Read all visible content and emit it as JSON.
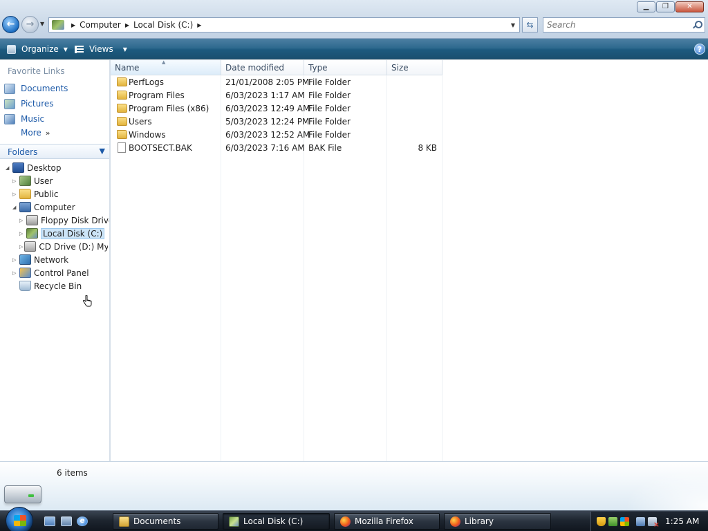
{
  "window": {
    "minimize": "▁",
    "maximize": "❐",
    "close": "✕"
  },
  "address": {
    "crumbs": [
      "Computer",
      "Local Disk (C:)"
    ]
  },
  "search": {
    "placeholder": "Search"
  },
  "toolbar": {
    "organize": "Organize",
    "views": "Views",
    "help": "?"
  },
  "navigation": {
    "favorites_heading": "Favorite Links",
    "favorites": [
      {
        "label": "Documents",
        "icon": "documents-icon"
      },
      {
        "label": "Pictures",
        "icon": "pictures-icon"
      },
      {
        "label": "Music",
        "icon": "music-icon"
      }
    ],
    "more": "More",
    "folders_heading": "Folders",
    "tree": [
      {
        "label": "Desktop",
        "icon": "desktop-icon",
        "expanded": true
      },
      {
        "label": "User",
        "icon": "user-icon",
        "expanded": false
      },
      {
        "label": "Public",
        "icon": "folder-icon",
        "expanded": false
      },
      {
        "label": "Computer",
        "icon": "computer-icon",
        "expanded": true
      },
      {
        "label": "Floppy Disk Drive",
        "icon": "floppy-icon",
        "expanded": false
      },
      {
        "label": "Local Disk (C:)",
        "icon": "local-disk-icon",
        "expanded": false,
        "selected": true
      },
      {
        "label": "CD Drive (D:) MyP",
        "icon": "cd-drive-icon",
        "expanded": false
      },
      {
        "label": "Network",
        "icon": "network-icon",
        "expanded": false
      },
      {
        "label": "Control Panel",
        "icon": "control-panel-icon",
        "expanded": false
      },
      {
        "label": "Recycle Bin",
        "icon": "recycle-bin-icon",
        "expanded": false
      }
    ]
  },
  "columns": [
    "Name",
    "Date modified",
    "Type",
    "Size"
  ],
  "files": [
    {
      "name": "PerfLogs",
      "date": "21/01/2008 2:05 PM",
      "type": "File Folder",
      "size": "",
      "icon": "folder-icon"
    },
    {
      "name": "Program Files",
      "date": "6/03/2023 1:17 AM",
      "type": "File Folder",
      "size": "",
      "icon": "folder-icon"
    },
    {
      "name": "Program Files (x86)",
      "date": "6/03/2023 12:49 AM",
      "type": "File Folder",
      "size": "",
      "icon": "folder-icon"
    },
    {
      "name": "Users",
      "date": "5/03/2023 12:24 PM",
      "type": "File Folder",
      "size": "",
      "icon": "folder-icon"
    },
    {
      "name": "Windows",
      "date": "6/03/2023 12:52 AM",
      "type": "File Folder",
      "size": "",
      "icon": "folder-icon"
    },
    {
      "name": "BOOTSECT.BAK",
      "date": "6/03/2023 7:16 AM",
      "type": "BAK File",
      "size": "8 KB",
      "icon": "file-icon"
    }
  ],
  "details": {
    "count": "6 items"
  },
  "taskbar": {
    "tasks": [
      {
        "label": "Documents",
        "icon": "folder-icon",
        "active": false
      },
      {
        "label": "Local Disk (C:)",
        "icon": "local-disk-icon",
        "active": true
      },
      {
        "label": "Mozilla Firefox",
        "icon": "firefox-icon",
        "active": false
      },
      {
        "label": "Library",
        "icon": "firefox-icon",
        "active": false
      }
    ],
    "clock": "1:25 AM"
  }
}
